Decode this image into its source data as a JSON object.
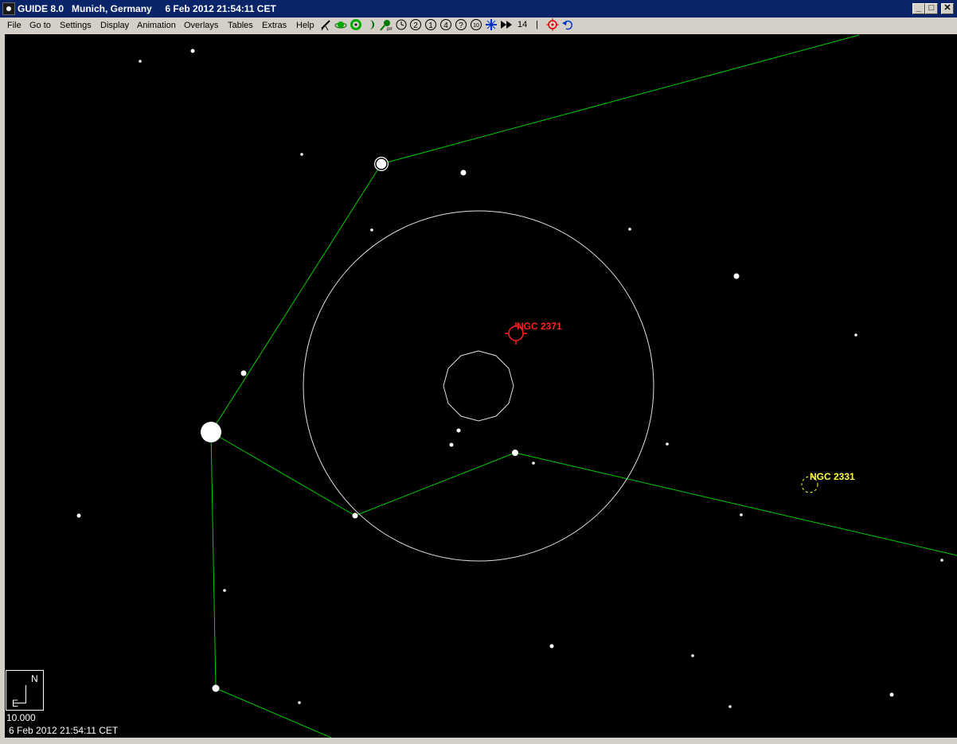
{
  "window": {
    "title": "GUIDE 8.0   Munich, Germany     6 Feb 2012 21:54:11 CET",
    "minimize_glyph": "_",
    "maximize_glyph": "□",
    "close_glyph": "✕"
  },
  "menu": [
    "File",
    "Go to",
    "Settings",
    "Display",
    "Animation",
    "Overlays",
    "Tables",
    "Extras",
    "Help"
  ],
  "toolbar": {
    "level_labels": [
      "1",
      "2",
      "3",
      "4",
      "?",
      "10"
    ],
    "level_14": "14",
    "level_sep": "|",
    "icons": [
      "telescope-icon",
      "planets-icon",
      "deep-sky-icon",
      "moon-icon",
      "comet-icon",
      "pm-icon",
      "clock-icon",
      "level-icon",
      "cross-icon",
      "fast-forward-icon",
      "target-icon",
      "undo-icon"
    ]
  },
  "chart": {
    "objects": [
      {
        "name": "NGC 2371",
        "color": "#ff2020"
      },
      {
        "name": "NGC 2331",
        "color": "#ffff40"
      }
    ],
    "compass": {
      "north": "N",
      "east": "E"
    },
    "fov": "10.000",
    "datetime": "6 Feb 2012 21:54:11 CET",
    "line_color": "#00cc00",
    "circle_color": "#e0e0e0"
  }
}
